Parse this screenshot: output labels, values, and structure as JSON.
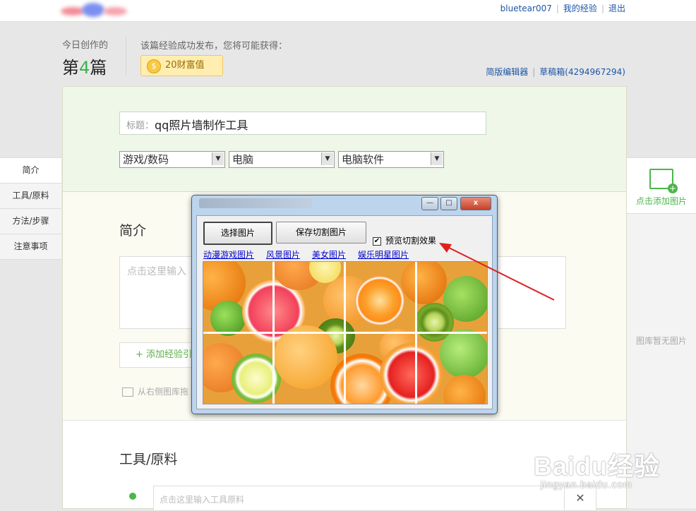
{
  "topbar": {
    "user": "bluetear007",
    "my_experience": "我的经验",
    "logout": "退出"
  },
  "header": {
    "today_label": "今日创作的",
    "count_prefix": "第",
    "count_num": "4",
    "count_suffix": "篇",
    "reward_label": "该篇经验成功发布，您将可能获得：",
    "reward": "20财富值",
    "simple_editor": "简版编辑器",
    "drafts": "草稿箱(4294967294)"
  },
  "form": {
    "title_label": "标题：",
    "title_value": "qq照片墙制作工具",
    "category1": "游戏/数码",
    "category2": "电脑",
    "category3": "电脑软件"
  },
  "sections": {
    "intro": "简介",
    "intro_placeholder": "点击这里输入",
    "add_button": "+ 添加经验引",
    "pic_hint": "从右侧图库拖",
    "tools": "工具/原料",
    "tools_placeholder": "点击这里输入工具原料",
    "close": "✕"
  },
  "leftnav": [
    "简介",
    "工具/原料",
    "方法/步骤",
    "注意事项"
  ],
  "rightpanel": {
    "add_image": "点击添加图片",
    "empty": "图库暂无图片"
  },
  "popup": {
    "min": "—",
    "max": "□",
    "close": "x",
    "select_image": "选择图片",
    "save_cut": "保存切割图片",
    "preview_label": "预览切割效果",
    "preview_checked": "✔",
    "links": [
      "动漫游戏图片",
      "风景图片",
      "美女图片",
      "娱乐明星图片"
    ]
  },
  "watermark": {
    "brand": "Baidu经验",
    "url": "jingyan.baidu.com"
  }
}
